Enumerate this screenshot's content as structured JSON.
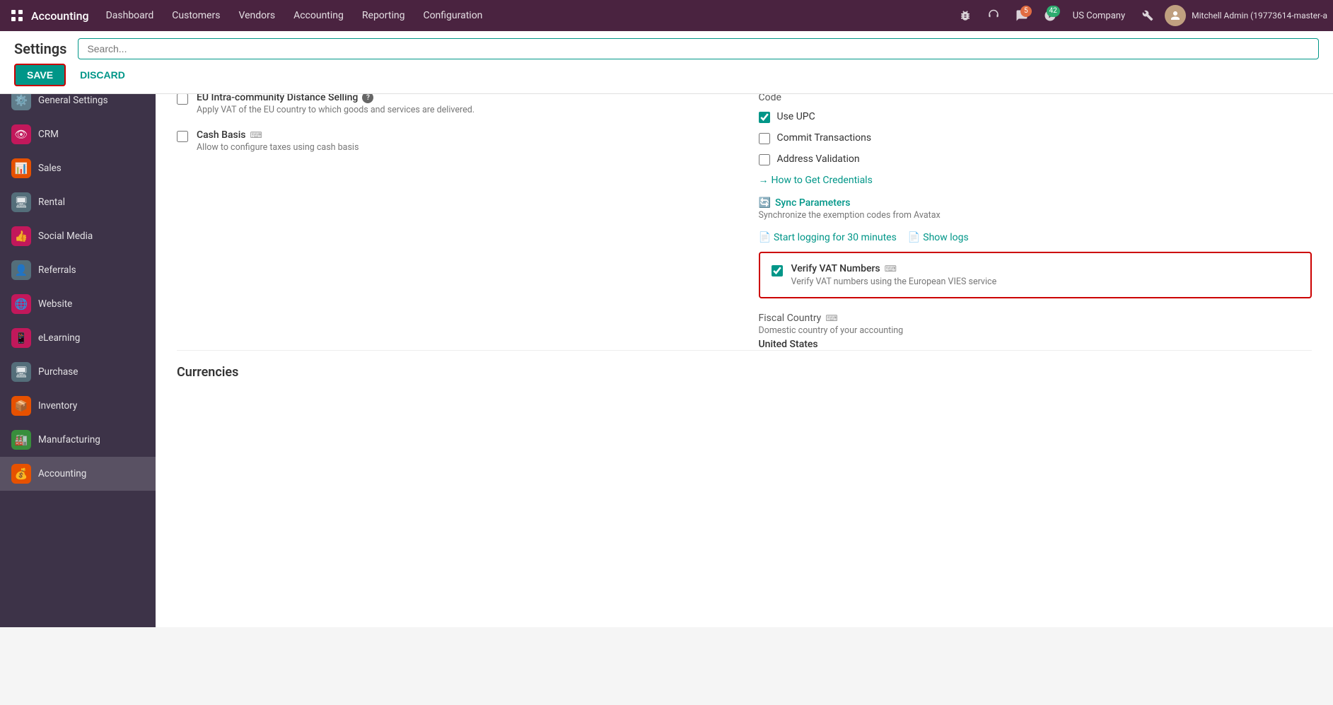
{
  "app": {
    "title": "Accounting"
  },
  "topnav": {
    "app_title": "Accounting",
    "menu_items": [
      "Dashboard",
      "Customers",
      "Vendors",
      "Accounting",
      "Reporting",
      "Configuration"
    ],
    "company": "US Company",
    "user": "Mitchell Admin (19773614-master-a",
    "badges": {
      "chat": "5",
      "activity": "42"
    }
  },
  "page": {
    "title": "Settings",
    "search_placeholder": "Search..."
  },
  "buttons": {
    "save": "SAVE",
    "discard": "DISCARD"
  },
  "sidebar": {
    "items": [
      {
        "label": "General Settings",
        "icon": "⚙️",
        "color": "#607d8b"
      },
      {
        "label": "CRM",
        "icon": "👁",
        "color": "#e91e63"
      },
      {
        "label": "Sales",
        "icon": "📊",
        "color": "#ff9800"
      },
      {
        "label": "Rental",
        "icon": "🖥",
        "color": "#607d8b"
      },
      {
        "label": "Social Media",
        "icon": "👍",
        "color": "#e91e63"
      },
      {
        "label": "Referrals",
        "icon": "👤",
        "color": "#607d8b"
      },
      {
        "label": "Website",
        "icon": "🌐",
        "color": "#e91e63"
      },
      {
        "label": "eLearning",
        "icon": "📱",
        "color": "#e91e63"
      },
      {
        "label": "Purchase",
        "icon": "🖥",
        "color": "#607d8b"
      },
      {
        "label": "Inventory",
        "icon": "📦",
        "color": "#ff9800"
      },
      {
        "label": "Manufacturing",
        "icon": "🏭",
        "color": "#4caf50"
      },
      {
        "label": "Accounting",
        "icon": "💰",
        "color": "#ff9800",
        "active": true
      }
    ]
  },
  "settings": {
    "left_col": {
      "eu_distance_selling": {
        "label": "EU Intra-community Distance Selling",
        "desc": "Apply VAT of the EU country to which goods and services are delivered.",
        "has_help": true,
        "checked": false
      },
      "cash_basis": {
        "label": "Cash Basis",
        "desc": "Allow to configure taxes using cash basis",
        "checked": false,
        "has_icon": true
      }
    },
    "right_col": {
      "code_label": "Code",
      "use_upc": {
        "label": "Use UPC",
        "checked": true
      },
      "commit_transactions": {
        "label": "Commit Transactions",
        "checked": false
      },
      "address_validation": {
        "label": "Address Validation",
        "checked": false
      },
      "how_to_get_credentials": "How to Get Credentials",
      "sync_parameters": "Sync Parameters",
      "sync_desc": "Synchronize the exemption codes from Avatax",
      "start_logging": "Start logging for 30 minutes",
      "show_logs": "Show logs",
      "verify_vat": {
        "label": "Verify VAT Numbers",
        "desc": "Verify VAT numbers using the European VIES service",
        "checked": true
      },
      "fiscal_country": {
        "label": "Fiscal Country",
        "desc": "Domestic country of your accounting",
        "value": "United States",
        "has_icon": true
      }
    }
  },
  "currencies": {
    "section_title": "Currencies"
  },
  "icons": {
    "grid": "⊞",
    "search": "🔍",
    "bug": "🐛",
    "headset": "🎧",
    "chat": "💬",
    "clock": "🕐",
    "wrench": "🔧",
    "arrow_right": "→",
    "sync": "🔄",
    "doc": "📄",
    "keyboard": "⌨"
  }
}
